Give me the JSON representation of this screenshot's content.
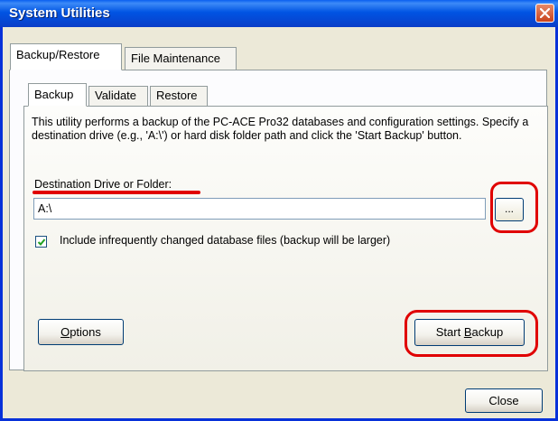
{
  "window": {
    "title": "System Utilities"
  },
  "outer_tabs": [
    {
      "label": "Backup/Restore",
      "active": true
    },
    {
      "label": "File Maintenance",
      "active": false
    }
  ],
  "inner_tabs": [
    {
      "label": "Backup",
      "active": true
    },
    {
      "label": "Validate",
      "active": false
    },
    {
      "label": "Restore",
      "active": false
    }
  ],
  "backup": {
    "description": "This utility performs a backup of the PC-ACE Pro32 databases and configuration settings. Specify a destination drive (e.g., 'A:\\') or hard disk folder path and click the 'Start Backup' button.",
    "destination_label": "Destination Drive or Folder:",
    "destination_value": "A:\\",
    "browse_label": "...",
    "include_checkbox_label": "Include infrequently changed database files (backup will be larger)",
    "include_checked": true,
    "options_label_prefix": "",
    "options_label_accel": "O",
    "options_label_rest": "ptions",
    "start_label_prefix": "Start ",
    "start_label_accel": "B",
    "start_label_rest": "ackup"
  },
  "footer": {
    "close_label": "Close"
  },
  "colors": {
    "annotation": "#e00000",
    "titlebar": "#0054e3"
  }
}
